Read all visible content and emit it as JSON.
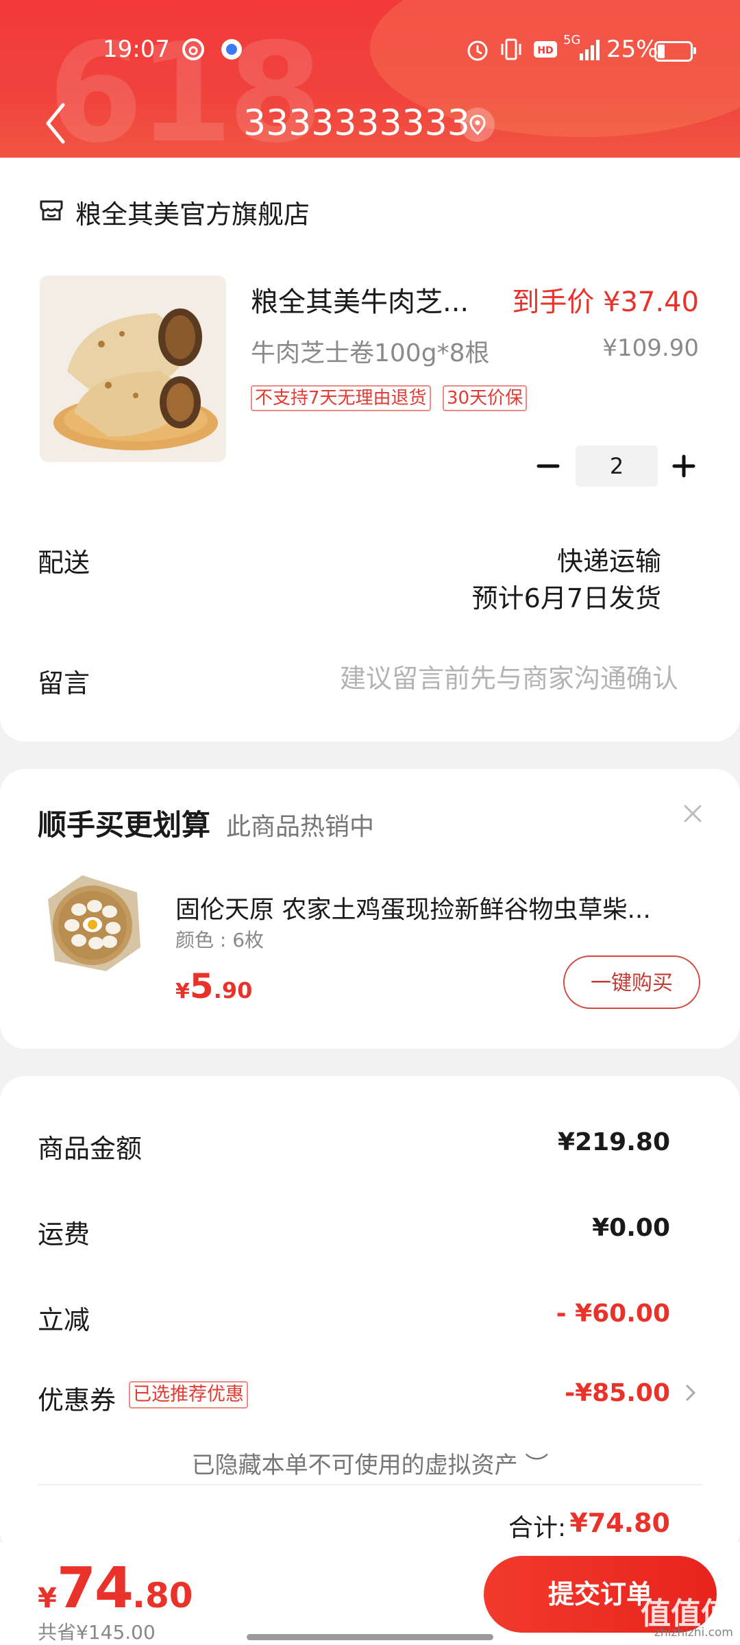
{
  "status_bar": {
    "time": "19:07",
    "network": "5G",
    "battery": "25%"
  },
  "header": {
    "title": "3333333333",
    "decor_text": "618"
  },
  "shop": {
    "name": "粮全其美官方旗舰店"
  },
  "product": {
    "title": "粮全其美牛肉芝...",
    "final_price": "到手价 ¥37.40",
    "spec": "牛肉芝士卷100g*8根",
    "original_price": "¥109.90",
    "tags": [
      "不支持7天无理由退货",
      "30天价保"
    ],
    "quantity": "2"
  },
  "shipping": {
    "label": "配送",
    "method": "快递运输",
    "eta": "预计6月7日发货"
  },
  "message": {
    "label": "留言",
    "placeholder": "建议留言前先与商家沟通确认"
  },
  "recommend": {
    "title": "顺手买更划算",
    "subtitle": "此商品热销中",
    "item_name": "固伦天原 农家土鸡蛋现捡新鲜谷物虫草柴...",
    "item_spec": "颜色 : 6枚",
    "price_currency": "¥",
    "price_int": "5",
    "price_dec": ".90",
    "buy_label": "一键购买"
  },
  "summary": {
    "goods_label": "商品金额",
    "goods_value": "¥219.80",
    "freight_label": "运费",
    "freight_value": "¥0.00",
    "discount_label": "立减",
    "discount_value": "- ¥60.00",
    "coupon_label": "优惠券",
    "coupon_tag": "已选推荐优惠",
    "coupon_value": "-¥85.00",
    "hidden_assets": "已隐藏本单不可使用的虚拟资产 ︶",
    "total_label": "合计:",
    "total_value": "¥74.80"
  },
  "bottom": {
    "price_currency": "¥",
    "price_int": "74",
    "price_dec": ".80",
    "saved": "共省¥145.00",
    "submit_label": "提交订单"
  },
  "watermark": {
    "main": "值值值",
    "sub": "zhizhizhi.com"
  },
  "colors": {
    "accent": "#e8322a",
    "header": "#f23a3a"
  }
}
